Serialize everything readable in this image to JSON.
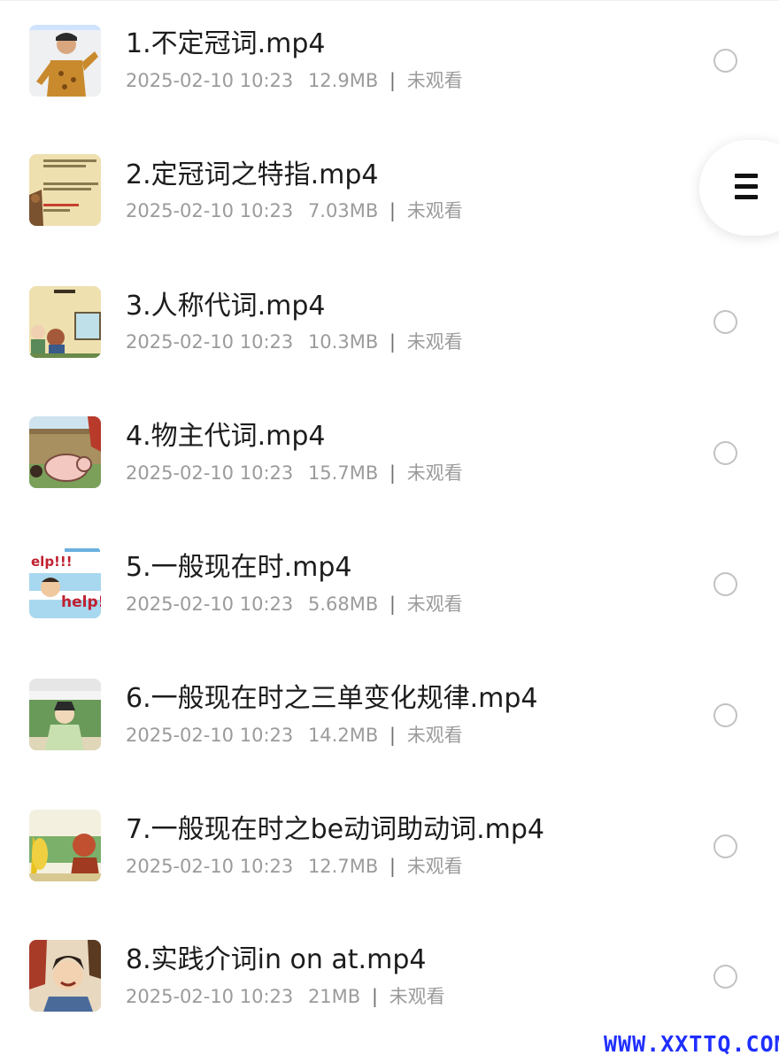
{
  "files": [
    {
      "title": "1.不定冠词.mp4",
      "date": "2025-02-10 10:23",
      "size": "12.9MB",
      "status": "未观看",
      "thumb": "thumb-dancer"
    },
    {
      "title": "2.定冠词之特指.mp4",
      "date": "2025-02-10 10:23",
      "size": "7.03MB",
      "status": "未观看",
      "thumb": "thumb-slide"
    },
    {
      "title": "3.人称代词.mp4",
      "date": "2025-02-10 10:23",
      "size": "10.3MB",
      "status": "未观看",
      "thumb": "thumb-classroom"
    },
    {
      "title": "4.物主代词.mp4",
      "date": "2025-02-10 10:23",
      "size": "15.7MB",
      "status": "未观看",
      "thumb": "thumb-pig"
    },
    {
      "title": "5.一般现在时.mp4",
      "date": "2025-02-10 10:23",
      "size": "5.68MB",
      "status": "未观看",
      "thumb": "thumb-help"
    },
    {
      "title": "6.一般现在时之三单变化规律.mp4",
      "date": "2025-02-10 10:23",
      "size": "14.2MB",
      "status": "未观看",
      "thumb": "thumb-scholar"
    },
    {
      "title": "7.一般现在时之be动词助动词.mp4",
      "date": "2025-02-10 10:23",
      "size": "12.7MB",
      "status": "未观看",
      "thumb": "thumb-banana"
    },
    {
      "title": "8.实践介词in on at.mp4",
      "date": "2025-02-10 10:23",
      "size": "21MB",
      "status": "未观看",
      "thumb": "thumb-warriors"
    }
  ],
  "floating_menu": {
    "icon": "hamburger-menu-icon"
  },
  "watermark": "WWW.XXTTQ.COM",
  "colors": {
    "title": "#1c1c1c",
    "meta": "#9b9b9b",
    "radio_border": "#c2c2c2",
    "watermark": "#1f2fff"
  }
}
